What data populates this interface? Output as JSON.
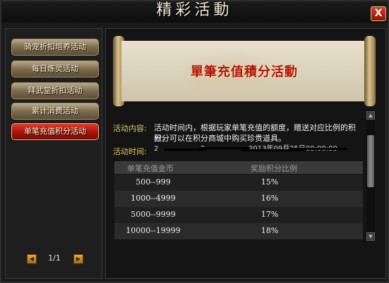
{
  "window": {
    "title": "精彩活動",
    "close_label": "X"
  },
  "menu": {
    "items": [
      {
        "label": "骑宠折扣培养活动",
        "active": false
      },
      {
        "label": "每日炼灵活动",
        "active": false
      },
      {
        "label": "拜武堂折扣活动",
        "active": false
      },
      {
        "label": "累计消费活动",
        "active": false
      },
      {
        "label": "单笔充值积分活动",
        "active": true
      }
    ]
  },
  "pager": {
    "text": "1/1"
  },
  "banner": {
    "title": "單筆充值積分活動"
  },
  "details": {
    "content_label": "活动内容:",
    "content_line1": "活动时间内，根据玩家单笔充值的额度，赠送对应比例的积分，",
    "content_line2": "积分可以在积分商城中购买珍贵道具。",
    "time_label": "活动时间:",
    "time_value_start": "2",
    "time_value_mid": "2",
    "time_value_end": "2013年09月25日09:00:00"
  },
  "table": {
    "headers": [
      "单笔充值金币",
      "奖励积分比例"
    ],
    "rows": [
      [
        "500--999",
        "15%"
      ],
      [
        "1000--4999",
        "16%"
      ],
      [
        "5000--9999",
        "17%"
      ],
      [
        "10000--19999",
        "18%"
      ]
    ]
  },
  "colors": {
    "accent_red": "#b21305",
    "label_yellow": "#d8c95a"
  }
}
